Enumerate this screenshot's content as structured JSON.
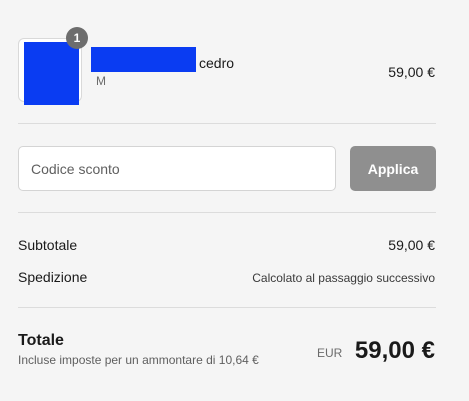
{
  "cart": {
    "item": {
      "name": "cedro",
      "variant": "M",
      "quantity": "1",
      "price": "59,00 €"
    }
  },
  "discount": {
    "placeholder": "Codice sconto",
    "apply_label": "Applica"
  },
  "summary": {
    "subtotal_label": "Subtotale",
    "subtotal_value": "59,00 €",
    "shipping_label": "Spedizione",
    "shipping_value": "Calcolato al passaggio successivo",
    "total_label": "Totale",
    "tax_note": "Incluse imposte per un ammontare di 10,64 €",
    "currency": "EUR",
    "total_value": "59,00 €"
  },
  "colors": {
    "redaction": "#0a3cf2",
    "button_disabled": "#8f8f8f",
    "badge": "#6d6d6d"
  }
}
